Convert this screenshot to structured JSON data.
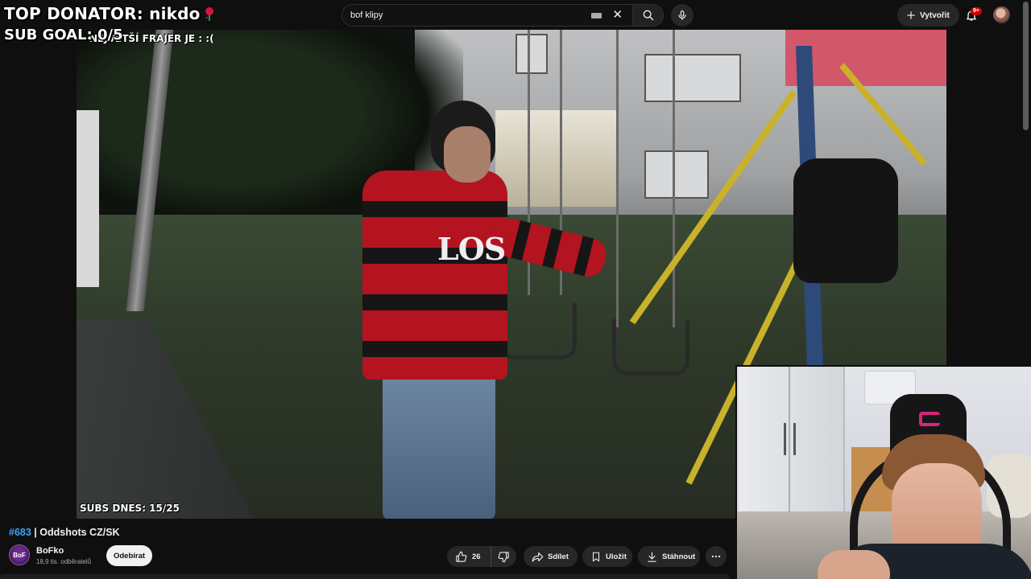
{
  "overlay": {
    "donator_text": "TOP DONATOR: nikdo",
    "sub_goal_text": "SUB GOAL: 0/5",
    "video_top_caption": "NEJVĚTŠÍ FRAJER JE :  :(",
    "subs_caption": "SUBS DNES: 15/25"
  },
  "header": {
    "search_value": "bof klipy",
    "create_label": "Vytvořit",
    "notification_count": "9+"
  },
  "video": {
    "shirt_text": "LOS",
    "title_hashtag": "#683",
    "title_rest": " | Oddshots CZ/SK"
  },
  "channel": {
    "avatar_text": "BoF",
    "name": "BoFko",
    "subscribers": "18,9 tis. odběratelů",
    "subscribe_label": "Odebírat"
  },
  "actions": {
    "like_count": "26",
    "share_label": "Sdílet",
    "save_label": "Uložit",
    "download_label": "Stáhnout"
  },
  "icons": {
    "search": "search-icon",
    "clear": "close-icon",
    "keyboard": "keyboard-icon",
    "mic": "mic-icon",
    "create": "plus-icon",
    "bell": "bell-icon",
    "like": "thumbs-up-icon",
    "dislike": "thumbs-down-icon",
    "share": "share-icon",
    "save": "bookmark-icon",
    "download": "download-icon",
    "more": "more-icon",
    "rose": "rose-icon"
  },
  "colors": {
    "background": "#0f0f0f",
    "pill": "#272727",
    "link_blue": "#3ea6ff",
    "badge_red": "#cc0000"
  }
}
